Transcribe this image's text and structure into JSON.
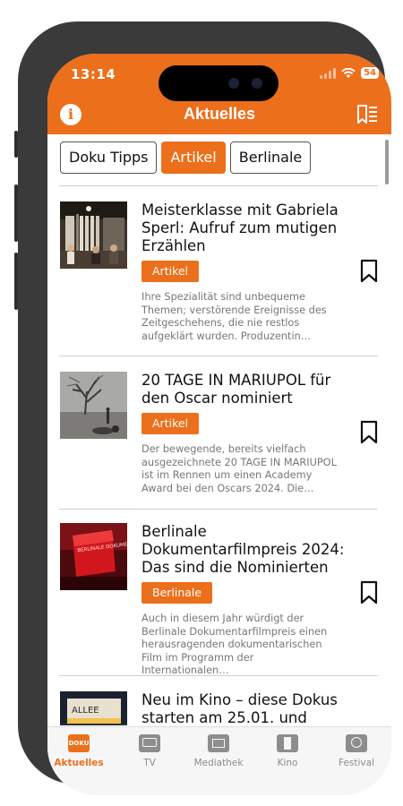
{
  "status": {
    "time": "13:14",
    "battery": "54"
  },
  "header": {
    "title": "Aktuelles"
  },
  "tabs": [
    {
      "label": "Doku Tipps",
      "active": false
    },
    {
      "label": "Artikel",
      "active": true
    },
    {
      "label": "Berlinale",
      "active": false
    }
  ],
  "articles": [
    {
      "title": "Meisterklasse mit Gabriela Sperl: Aufruf zum mutigen Erzählen",
      "badge": "Artikel",
      "excerpt": "Ihre Spezialität sind unbequeme Themen; verstörende Ereignisse des Zeitgeschehens, die nie restlos aufgeklärt wurden. Produzentin…"
    },
    {
      "title": "20 TAGE IN MARIUPOL für den Oscar nominiert",
      "badge": "Artikel",
      "excerpt": "Der bewegende, bereits vielfach ausgezeichnete 20 TAGE IN MARIUPOL ist im Rennen um einen Academy Award bei den Oscars 2024. Die…"
    },
    {
      "title": "Berlinale Dokumentarfilmpreis 2024: Das sind die Nominierten",
      "badge": "Berlinale",
      "excerpt": "Auch in diesem Jahr würdigt der Berlinale Dokumentarfilmpreis einen herausragenden dokumentarischen Film im Programm der Internationalen…",
      "thumb_text": "BERLINALE DOKUMENTAR FILMPREIS AWARD"
    },
    {
      "title": "Neu im Kino – diese Dokus starten am 25.01. und",
      "thumb_text": "ALLEE"
    }
  ],
  "bottom_nav": [
    {
      "label": "Aktuelles",
      "icon": "doku-logo-icon",
      "active": true,
      "icon_text": "DOKU"
    },
    {
      "label": "TV",
      "icon": "tv-icon",
      "active": false
    },
    {
      "label": "Mediathek",
      "icon": "mediathek-icon",
      "active": false
    },
    {
      "label": "Kino",
      "icon": "film-icon",
      "active": false
    },
    {
      "label": "Festival",
      "icon": "festival-icon",
      "active": false
    }
  ],
  "colors": {
    "accent": "#ec6f1c",
    "text": "#111111",
    "muted": "#777777",
    "nav_inactive": "#8d8d8d"
  }
}
